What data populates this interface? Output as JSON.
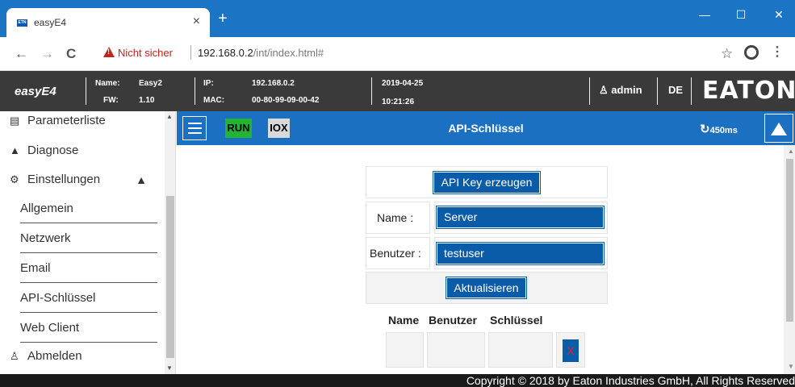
{
  "browser": {
    "tab_title": "easyE4",
    "favicon_text": "ETN",
    "tab_close": "×",
    "new_tab": "+",
    "window_controls": {
      "minimize": "—",
      "maximize": "☐",
      "close": "✕"
    },
    "nav": {
      "back": "←",
      "forward": "→",
      "reload": "C"
    },
    "security_label": "Nicht sicher",
    "url_host": "192.168.0.2",
    "url_path": "/int/index.html#",
    "bookmark": "☆",
    "menu": "⋮"
  },
  "header": {
    "brand": "easyE4",
    "name_label": "Name:",
    "name_value": "Easy2",
    "fw_label": "FW:",
    "fw_value": "1.10",
    "ip_label": "IP:",
    "ip_value": "192.168.0.2",
    "mac_label": "MAC:",
    "mac_value": "00-80-99-09-00-42",
    "date": "2019-04-25",
    "time": "10:21:26",
    "user_icon": "user-icon",
    "user": "admin",
    "language": "DE",
    "logo": "EATON"
  },
  "sidebar": {
    "items": [
      {
        "label": "Parameterliste",
        "icon": "list-icon"
      },
      {
        "label": "Diagnose",
        "icon": "warning-icon"
      },
      {
        "label": "Einstellungen",
        "icon": "gear-icon"
      },
      {
        "label": "Allgemein"
      },
      {
        "label": "Netzwerk"
      },
      {
        "label": "Email"
      },
      {
        "label": "API-Schlüssel"
      },
      {
        "label": "Web Client"
      },
      {
        "label": "Abmelden",
        "icon": "user-icon"
      }
    ]
  },
  "toolbar": {
    "run_label": "RUN",
    "iox_label": "IOX",
    "page_title": "API-Schlüssel",
    "cycle_time": "450ms",
    "run_color": "#21b533",
    "bar_color": "#1b70c1"
  },
  "form": {
    "generate_button": "API Key erzeugen",
    "name_label": "Name :",
    "name_value": "Server",
    "user_label": "Benutzer :",
    "user_value": "testuser",
    "update_button": "Aktualisieren"
  },
  "table": {
    "headers": [
      "Name",
      "Benutzer",
      "Schlüssel"
    ],
    "delete_label": "X"
  },
  "footer": {
    "copyright": "Copyright © 2018 by Eaton Industries GmbH, All Rights Reserved"
  }
}
